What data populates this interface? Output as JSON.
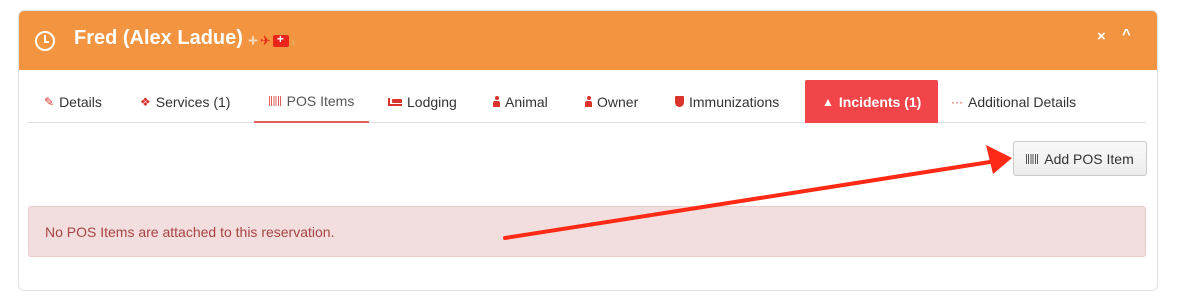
{
  "header": {
    "title": "Fred (Alex Ladue)",
    "icons": [
      "plus-icon",
      "plane-icon",
      "first-aid-kit-icon",
      "chevron-right-icon"
    ],
    "close_glyph": "×",
    "collapse_glyph": "^"
  },
  "tabs": [
    {
      "label": "Details",
      "icon": "edit-icon"
    },
    {
      "label": "Services (1)",
      "icon": "cubes-icon"
    },
    {
      "label": "POS Items",
      "icon": "barcode-icon"
    },
    {
      "label": "Lodging",
      "icon": "bed-icon"
    },
    {
      "label": "Animal",
      "icon": "user-icon"
    },
    {
      "label": "Owner",
      "icon": "male-icon"
    },
    {
      "label": "Immunizations",
      "icon": "shield-icon"
    },
    {
      "label": "Incidents (1)",
      "icon": "warning-icon"
    },
    {
      "label": "Additional Details",
      "icon": "ellipsis-icon"
    }
  ],
  "add_button": {
    "label": "Add POS Item",
    "icon": "barcode-icon"
  },
  "alert": {
    "message": "No POS Items are attached to this reservation."
  },
  "colors": {
    "header": "#f39540",
    "accent_red": "#f2454a",
    "alert_bg": "#f2dede",
    "alert_text": "#a94442",
    "arrow": "#ff2a16"
  }
}
